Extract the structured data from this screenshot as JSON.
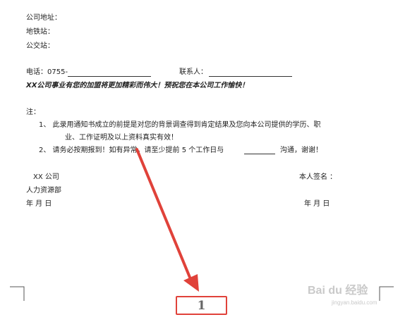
{
  "document": {
    "address_label": "公司地址：",
    "sub_label": "地铁站：",
    "bus_label": "公交站：",
    "phone_label": "电话：0755-",
    "contact_label": "联系人：",
    "slogan": "XX公司事业有您的加盟将更加精彩而伟大！预祝您在本公司工作愉快！",
    "note_label": "注：",
    "note1_line1": "1、    此录用通知书成立的前提是对您的背景调查得到肯定结果及您向本公司提供的学历、职",
    "note1_line2": "业、工作证明及以上资料真实有效！",
    "note2_start": "2、    请务必按期报到！如有异常，请至少提前 5 个工作日与",
    "note2_end": "沟通，谢谢！",
    "company": "XX 公司",
    "department": "人力资源部",
    "date_left": "年        月        日",
    "signature_label": "本人签名 ：",
    "date_right": "年        月        日",
    "page_number": "1"
  },
  "watermark": {
    "text": "Bai du 经验",
    "url": "jingyan.baidu.com"
  },
  "colors": {
    "arrow": "#e0423a",
    "box_border": "#e0423a"
  }
}
